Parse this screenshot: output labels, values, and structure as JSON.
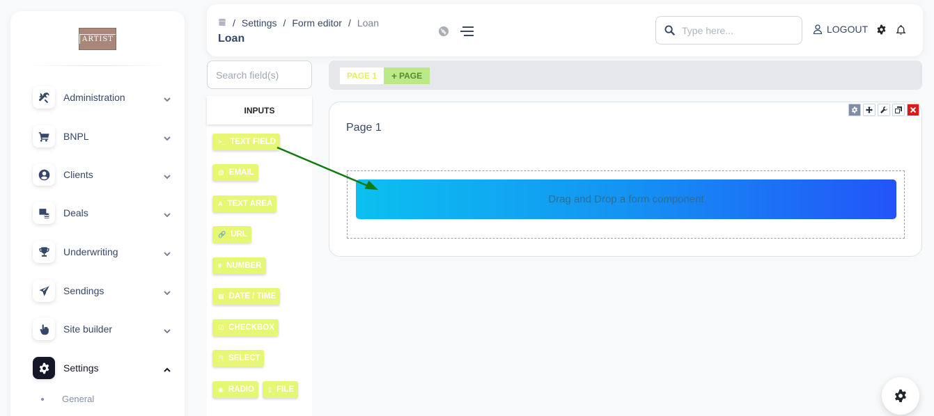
{
  "sidebar": {
    "logo_text": "ARTIST",
    "items": [
      {
        "label": "Administration",
        "icon": "tools-icon"
      },
      {
        "label": "BNPL",
        "icon": "cart-icon"
      },
      {
        "label": "Clients",
        "icon": "user-circle-icon"
      },
      {
        "label": "Deals",
        "icon": "deals-icon"
      },
      {
        "label": "Underwriting",
        "icon": "trophy-icon"
      },
      {
        "label": "Sendings",
        "icon": "paper-plane-icon"
      },
      {
        "label": "Site builder",
        "icon": "hand-pointer-icon"
      },
      {
        "label": "Settings",
        "icon": "gear-icon",
        "active": true
      }
    ],
    "sub_items": [
      {
        "label": "General"
      }
    ]
  },
  "header": {
    "breadcrumb": [
      "Settings",
      "Form editor",
      "Loan"
    ],
    "title": "Loan",
    "search_placeholder": "Type here...",
    "logout_label": "LOGOUT"
  },
  "fields": {
    "search_placeholder": "Search field(s)",
    "tab_label": "INPUTS",
    "buttons": [
      {
        "glyph": ">_",
        "label": "TEXT FIELD"
      },
      {
        "glyph": "@",
        "label": "EMAIL"
      },
      {
        "glyph": "A",
        "label": "TEXT AREA"
      },
      {
        "glyph": "🔗",
        "label": "URL"
      },
      {
        "glyph": "#",
        "label": "NUMBER"
      },
      {
        "glyph": "▦",
        "label": "DATE / TIME"
      },
      {
        "glyph": "☑",
        "label": "CHECKBOX"
      },
      {
        "glyph": "☰",
        "label": "SELECT"
      },
      {
        "glyph": "◉",
        "label": "RADIO"
      },
      {
        "glyph": "▯",
        "label": "FILE"
      }
    ]
  },
  "editor": {
    "tabs": {
      "page_label": "PAGE 1",
      "add_label": "PAGE",
      "add_glyph": "+"
    },
    "page_title": "Page 1",
    "dropzone_text": "Drag and Drop a form component"
  },
  "colors": {
    "field_button": "#e6f773",
    "add_page": "#bbe98a",
    "arrow": "#117a11",
    "drop_gradient_start": "#0bc0f0",
    "drop_gradient_end": "#2354f8"
  }
}
